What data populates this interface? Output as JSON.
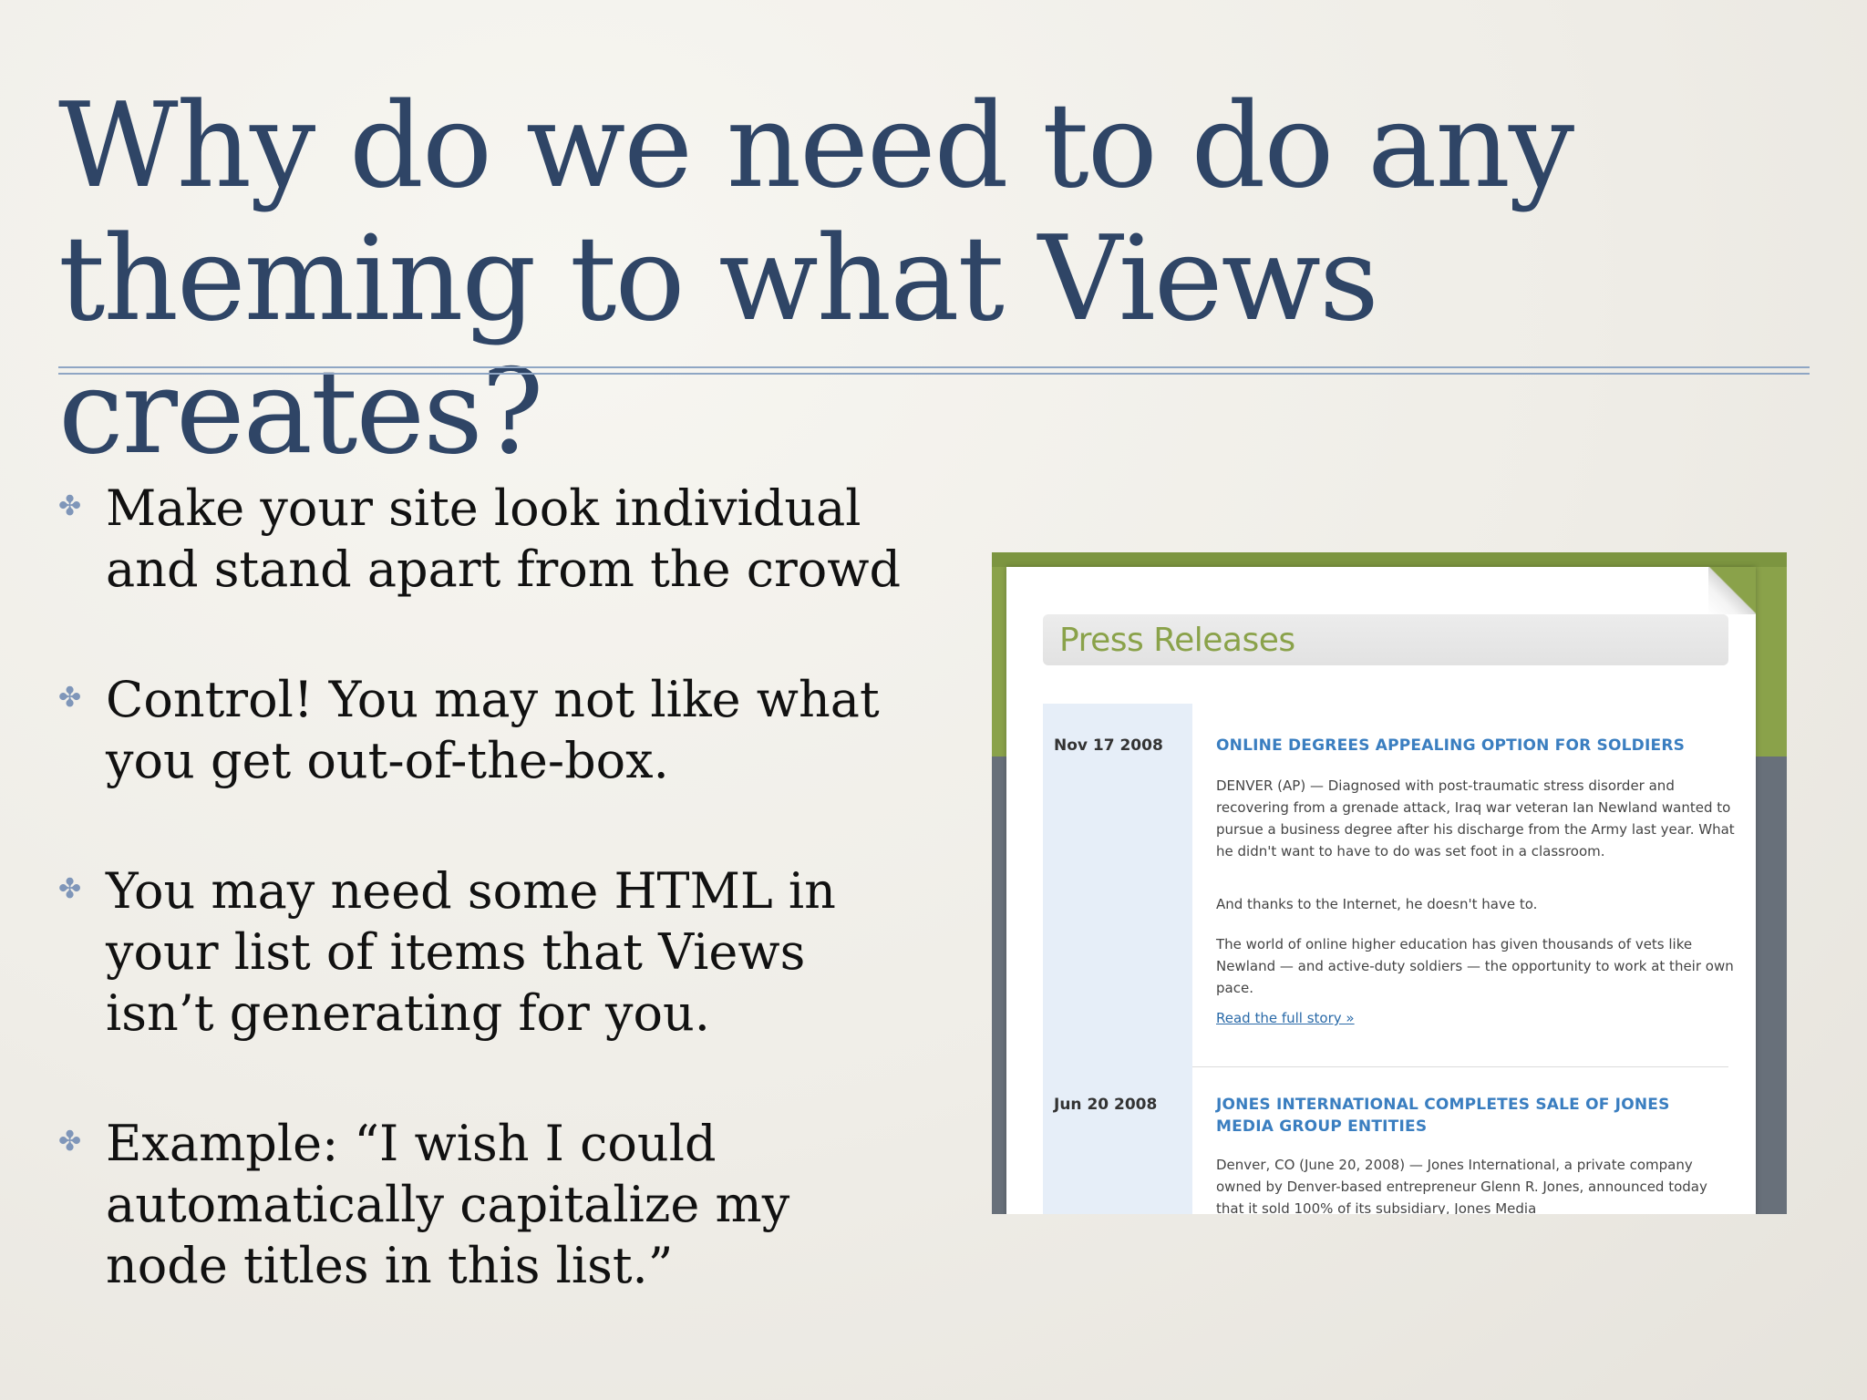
{
  "slide": {
    "title": "Why do we need to do any theming to what Views creates?",
    "bullets": [
      "Make your site look individual and stand apart from the crowd",
      "Control! You may not like what you get out-of-the-box.",
      "You may need some HTML in your list of items that Views isn’t generating for you.",
      "Example: “I wish I could automatically capitalize my node titles in this list.”"
    ],
    "bullet_icon": "✤"
  },
  "screenshot": {
    "heading": "Press Releases",
    "entries": [
      {
        "date": "Nov 17 2008",
        "title": "ONLINE DEGREES APPEALING OPTION FOR SOLDIERS",
        "paragraphs": [
          "DENVER (AP) — Diagnosed with post-traumatic stress disorder and recovering from a grenade attack, Iraq war veteran Ian Newland wanted to pursue a business degree after his discharge from the Army last year. What he didn't want to have to do was set foot in a classroom.",
          "And thanks to the Internet, he doesn't have to.",
          "The world of online higher education has given thousands of vets like Newland — and active-duty soldiers — the opportunity to work at their own pace."
        ],
        "link": "Read the full story »"
      },
      {
        "date": "Jun 20 2008",
        "title": "JONES INTERNATIONAL COMPLETES SALE OF JONES MEDIA GROUP ENTITIES",
        "paragraphs": [
          "Denver, CO (June 20, 2008) — Jones International, a private company owned by Denver-based entrepreneur Glenn R. Jones, announced today that it sold 100% of its subsidiary, Jones Media"
        ]
      }
    ],
    "colors": {
      "green": "#8aa24a",
      "gray": "#68707a",
      "title_blue": "#3a7ec0",
      "date_col": "#e6eef8"
    }
  }
}
